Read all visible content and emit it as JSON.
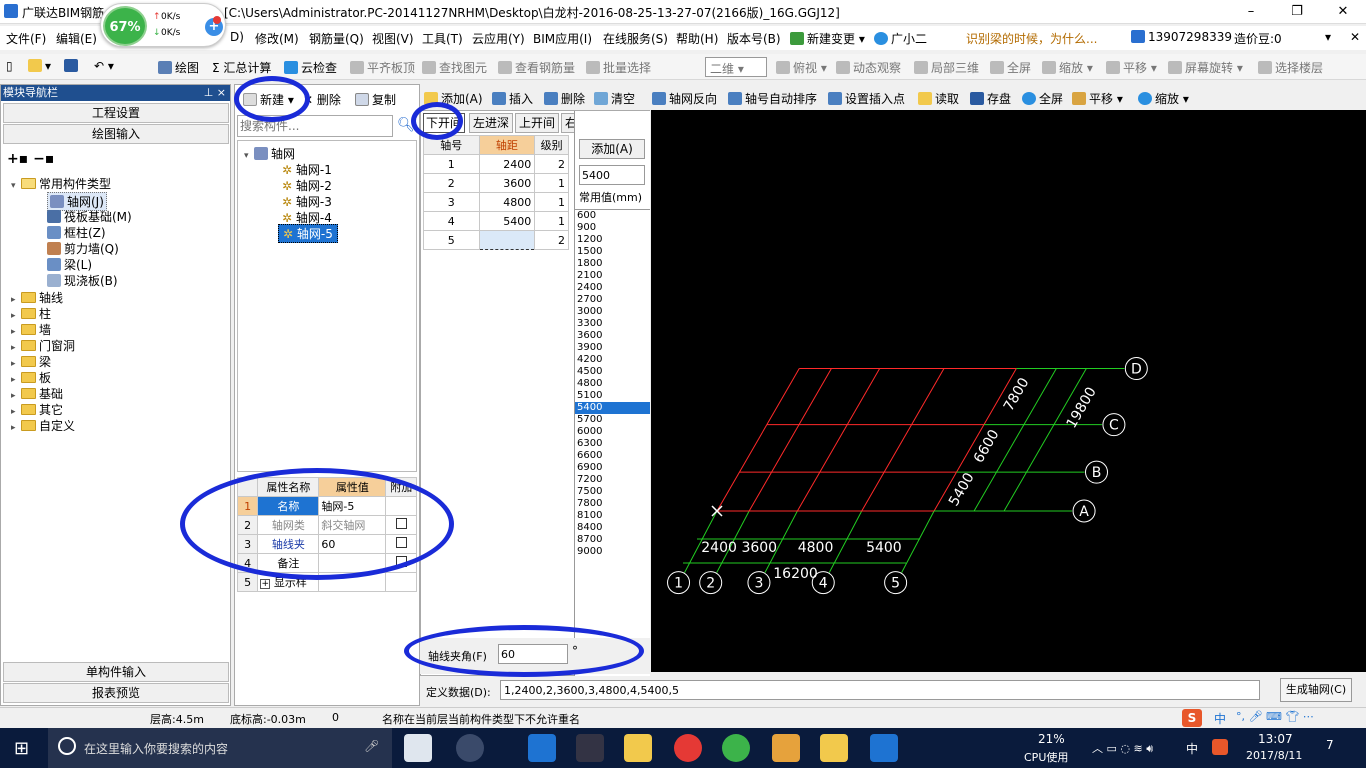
{
  "window": {
    "app_title": "广联达BIM钢筋",
    "path": "[C:\\Users\\Administrator.PC-20141127NRHM\\Desktop\\白龙村-2016-08-25-13-27-07(2166版)_16G.GGJ12]",
    "minimize": "–",
    "maximize": "❐",
    "close": "✕"
  },
  "net_widget": {
    "percent": "67%",
    "up": "0K/s",
    "down": "0K/s"
  },
  "menu": [
    "文件(F)",
    "编辑(E)",
    "D)",
    "修改(M)",
    "钢筋量(Q)",
    "视图(V)",
    "工具(T)",
    "云应用(Y)",
    "BIM应用(I)",
    "在线服务(S)",
    "帮助(H)",
    "版本号(B)",
    "新建变更 ▾",
    "广小二"
  ],
  "menu_tip": "识别梁的时候，为什么...",
  "account": {
    "phone": "13907298339",
    "bean": "造价豆:0"
  },
  "toolbar1": [
    "绘图",
    "Σ 汇总计算",
    "云检查",
    "平齐板顶",
    "查找图元",
    "查看钢筋量",
    "批量选择",
    "二维",
    "俯视",
    "动态观察",
    "局部三维",
    "全屏",
    "缩放",
    "平移",
    "屏幕旋转",
    "选择楼层"
  ],
  "nav": {
    "header": "模块导航栏",
    "pin": "⊥ ×",
    "btn_settings": "工程设置",
    "btn_drawing": "绘图输入",
    "btn_single": "单构件输入",
    "btn_report": "报表预览",
    "tree_root": "常用构件类型",
    "common": [
      "轴网(J)",
      "筏板基础(M)",
      "框柱(Z)",
      "剪力墙(Q)",
      "梁(L)",
      "现浇板(B)"
    ],
    "folders": [
      "轴线",
      "柱",
      "墙",
      "门窗洞",
      "梁",
      "板",
      "基础",
      "其它",
      "自定义"
    ]
  },
  "mid": {
    "new": "新建",
    "delete": "删除",
    "copy": "复制",
    "search_placeholder": "搜索构件...",
    "tree_root": "轴网",
    "items": [
      "轴网-1",
      "轴网-2",
      "轴网-3",
      "轴网-4",
      "轴网-5"
    ],
    "prop_headers": [
      "属性名称",
      "属性值",
      "附加"
    ],
    "props": [
      {
        "n": "1",
        "name": "名称",
        "value": "轴网-5"
      },
      {
        "n": "2",
        "name": "轴网类",
        "value": "斜交轴网"
      },
      {
        "n": "3",
        "name": "轴线夹",
        "value": "60"
      },
      {
        "n": "4",
        "name": "备注",
        "value": ""
      },
      {
        "n": "5",
        "name": "显示样",
        "value": ""
      }
    ]
  },
  "axis_toolbar": [
    "添加(A)",
    "插入",
    "删除",
    "清空",
    "轴网反向",
    "轴号自动排序",
    "设置插入点",
    "读取",
    "存盘",
    "全屏",
    "平移",
    "缩放"
  ],
  "axis": {
    "tabs": [
      "下开间",
      "左进深",
      "上开间",
      "右进深"
    ],
    "headers": [
      "轴号",
      "轴距",
      "级别"
    ],
    "rows": [
      {
        "no": "1",
        "dist": "2400",
        "lvl": "2"
      },
      {
        "no": "2",
        "dist": "3600",
        "lvl": "1"
      },
      {
        "no": "3",
        "dist": "4800",
        "lvl": "1"
      },
      {
        "no": "4",
        "dist": "5400",
        "lvl": "1"
      },
      {
        "no": "5",
        "dist": "",
        "lvl": "2"
      }
    ],
    "add_btn": "添加(A)",
    "value": "5400",
    "common_label": "常用值(mm)",
    "common_values": [
      "600",
      "900",
      "1200",
      "1500",
      "1800",
      "2100",
      "2400",
      "2700",
      "3000",
      "3300",
      "3600",
      "3900",
      "4200",
      "4500",
      "4800",
      "5100",
      "5400",
      "5700",
      "6000",
      "6300",
      "6600",
      "6900",
      "7200",
      "7500",
      "7800",
      "8100",
      "8400",
      "8700",
      "9000"
    ],
    "selected": "5400",
    "angle_label": "轴线夹角(F)",
    "angle": "60",
    "degree": "°",
    "define_label": "定义数据(D):",
    "define": "1,2400,2,3600,3,4800,4,5400,5",
    "gen_btn": "生成轴网(C)"
  },
  "cad": {
    "bottom_dims": [
      "2400",
      "3600",
      "4800",
      "5400"
    ],
    "total_bottom": "16200",
    "side_dims": [
      "5400",
      "6600",
      "7800"
    ],
    "total_side": "19800",
    "x_axes": [
      "1",
      "2",
      "3",
      "4",
      "5"
    ],
    "y_axes": [
      "A",
      "B",
      "C",
      "D"
    ]
  },
  "status": {
    "floor": "层高:4.5m",
    "base": "底标高:-0.03m",
    "zero": "0",
    "msg": "名称在当前层当前构件类型下不允许重名"
  },
  "taskbar": {
    "search": "在这里输入你要搜索的内容",
    "cpu_pct": "21%",
    "cpu": "CPU使用",
    "time": "13:07",
    "date": "2017/8/11",
    "ime": "中",
    "notif": "7"
  },
  "colors": {
    "grid": "#ff2a2a",
    "dim": "#22cc22",
    "highlight": "#1e73d2",
    "annotation": "#1a2bd8"
  }
}
